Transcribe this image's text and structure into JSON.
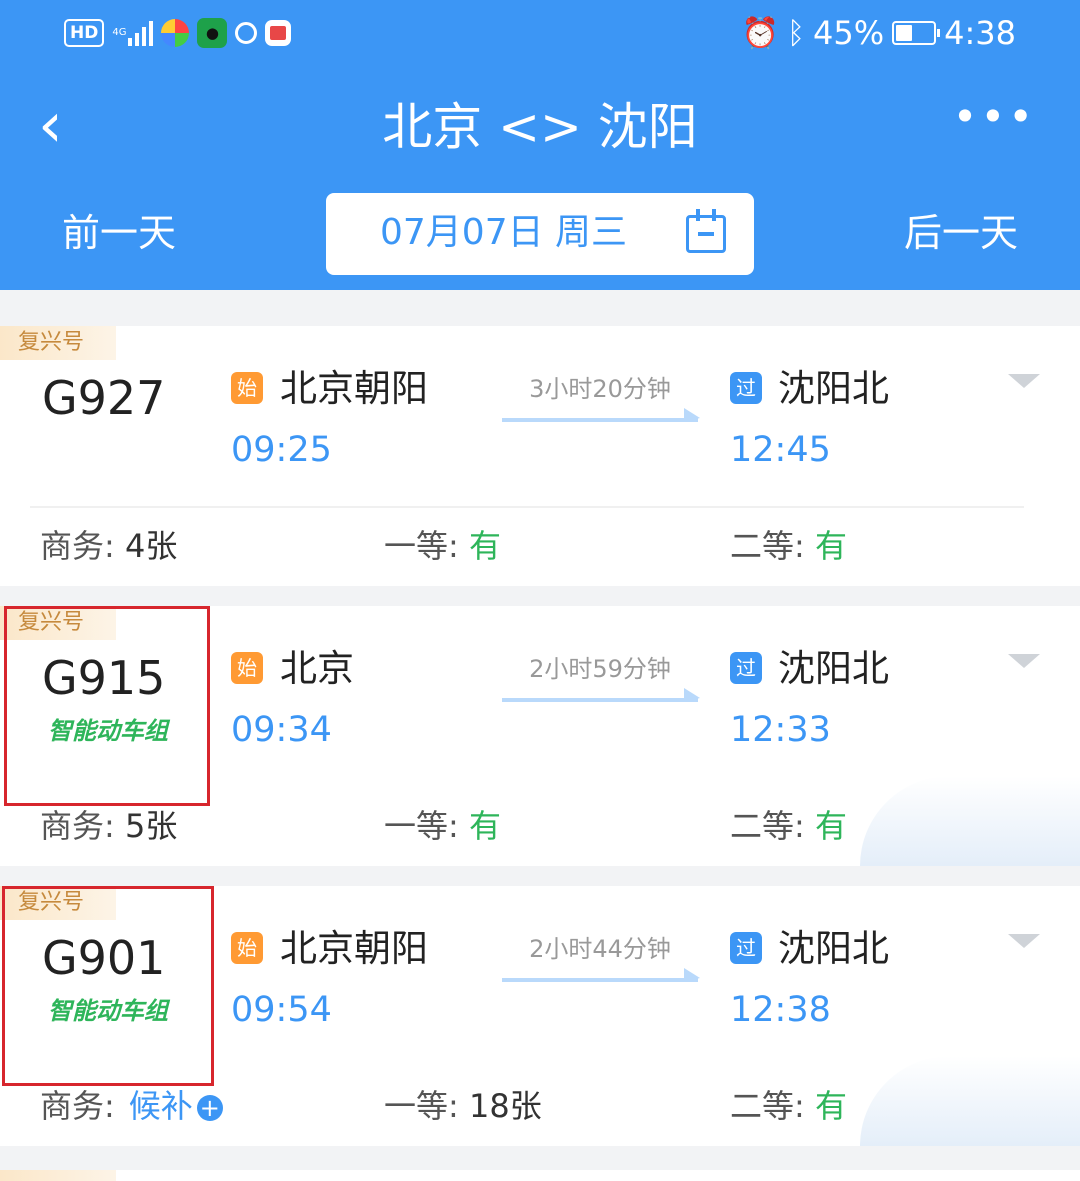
{
  "status_bar": {
    "left": {
      "hd": "HD",
      "signal": "4G"
    },
    "right": {
      "battery": "45%",
      "time": "4:38"
    }
  },
  "header": {
    "title": "北京 <> 沈阳",
    "prev_day": "前一天",
    "next_day": "后一天",
    "date": "07月07日 周三"
  },
  "trains": [
    {
      "tag": "复兴号",
      "train_no": "G927",
      "smart": "",
      "start_badge": "始",
      "from": "北京朝阳",
      "dep": "09:25",
      "duration": "3小时20分钟",
      "pass_badge": "过",
      "to": "沈阳北",
      "arr": "12:45",
      "seat1_label": "商务:",
      "seat1_value": "4张",
      "seat2_label": "一等:",
      "seat2_value": "有",
      "seat3_label": "二等:",
      "seat3_value": "有"
    },
    {
      "tag": "复兴号",
      "train_no": "G915",
      "smart": "智能动车组",
      "start_badge": "始",
      "from": "北京",
      "dep": "09:34",
      "duration": "2小时59分钟",
      "pass_badge": "过",
      "to": "沈阳北",
      "arr": "12:33",
      "seat1_label": "商务:",
      "seat1_value": "5张",
      "seat2_label": "一等:",
      "seat2_value": "有",
      "seat3_label": "二等:",
      "seat3_value": "有"
    },
    {
      "tag": "复兴号",
      "train_no": "G901",
      "smart": "智能动车组",
      "start_badge": "始",
      "from": "北京朝阳",
      "dep": "09:54",
      "duration": "2小时44分钟",
      "pass_badge": "过",
      "to": "沈阳北",
      "arr": "12:38",
      "seat1_label": "商务:",
      "seat1_value": "候补",
      "seat2_label": "一等:",
      "seat2_value": "18张",
      "seat3_label": "二等:",
      "seat3_value": "有"
    }
  ],
  "colors": {
    "primary": "#3c96f5",
    "available": "#2eb55a",
    "highlight": "#d7262d"
  }
}
